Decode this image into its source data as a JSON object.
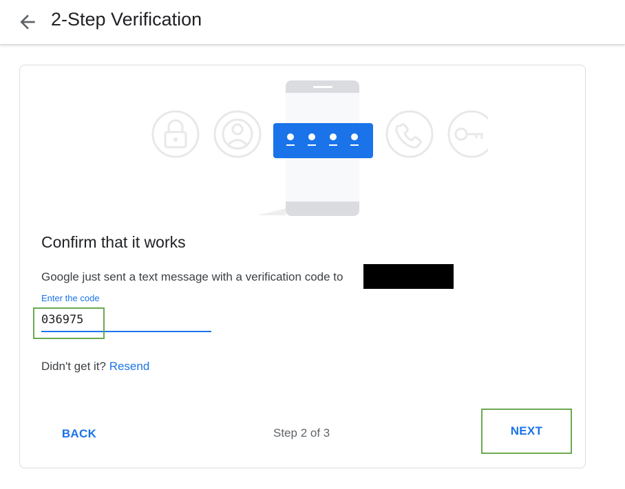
{
  "header": {
    "title": "2-Step Verification",
    "back_icon": "arrow-back-icon"
  },
  "illustration": {
    "icons": [
      "lock-icon",
      "account-circle-icon",
      "phone-icon",
      "key-icon"
    ],
    "code_dots": 4
  },
  "main": {
    "heading": "Confirm that it works",
    "message": "Google just sent a text message with a verification code to",
    "code_label": "Enter the code",
    "code_value": "036975",
    "didnt_get_it": "Didn't get it?",
    "resend_label": "Resend"
  },
  "footer": {
    "back_label": "BACK",
    "step_text": "Step 2 of 3",
    "next_label": "NEXT"
  },
  "colors": {
    "accent": "#1a73e8",
    "highlight": "#6aa84f",
    "icon_gray": "#e8e8e8"
  }
}
